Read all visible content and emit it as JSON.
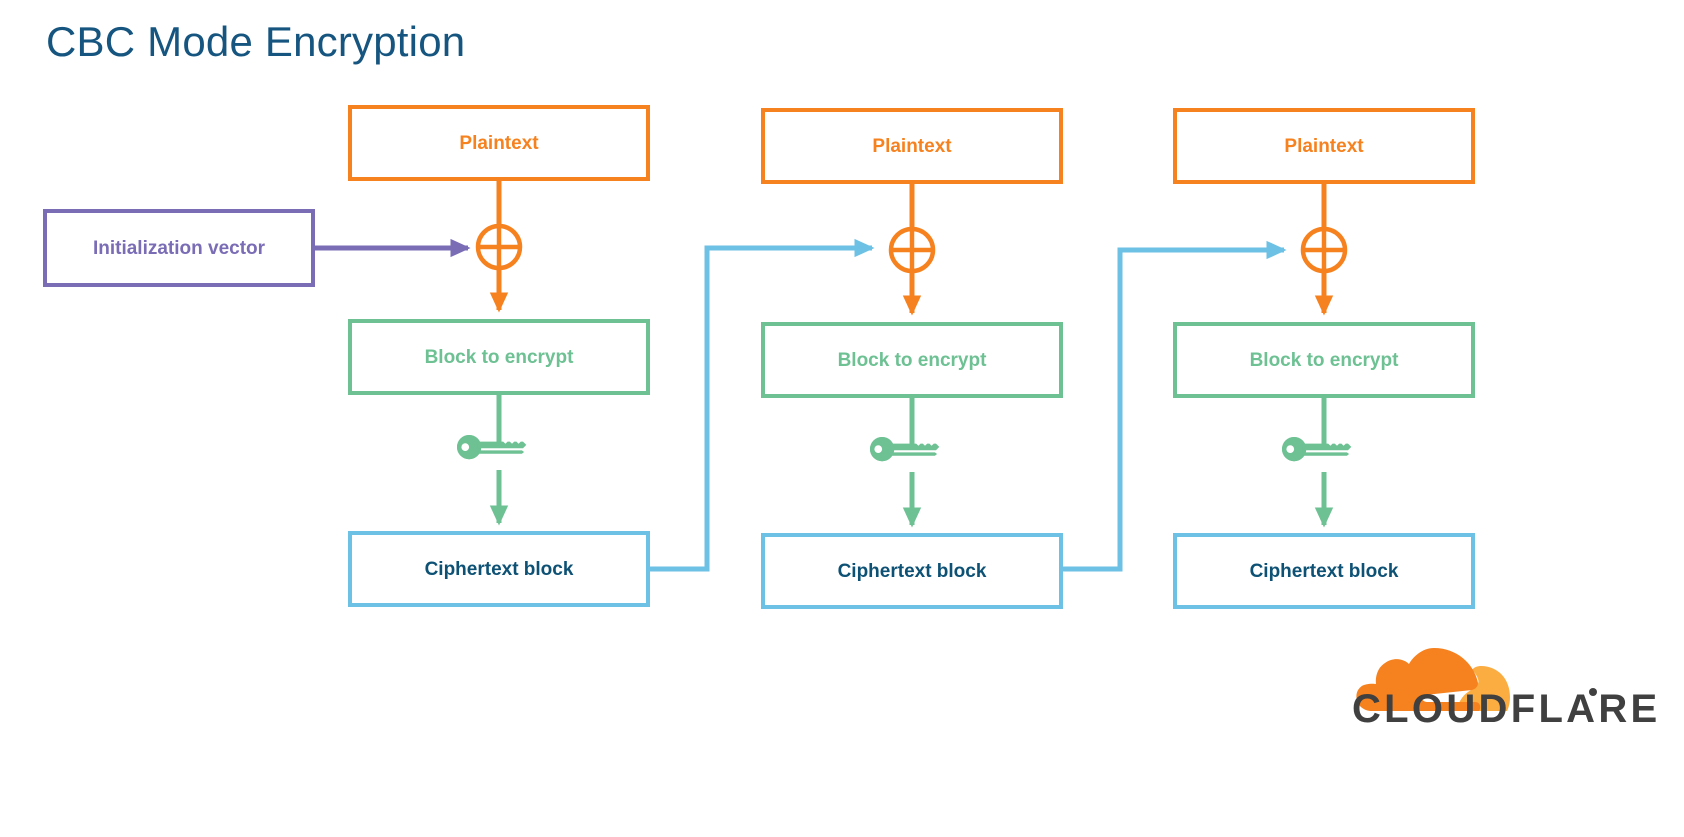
{
  "title": "CBC Mode Encryption",
  "theme": {
    "title_color": "#15557f",
    "plaintext_color": "#f6821f",
    "block_color": "#6dc193",
    "ciphertext_border_color": "#6cc1e5",
    "ciphertext_text_color": "#0d5175",
    "iv_color": "#7a6cb5",
    "background": "#ffffff"
  },
  "iv": {
    "label": "Initialization vector"
  },
  "labels": {
    "plaintext": "Plaintext",
    "block_to_encrypt": "Block to encrypt",
    "ciphertext_block": "Ciphertext block",
    "xor": "⊕",
    "key": "key-icon"
  },
  "stages": [
    {
      "index": 1,
      "plaintext": "Plaintext",
      "block": "Block to encrypt",
      "ciphertext": "Ciphertext block",
      "xor_input": "Initialization vector"
    },
    {
      "index": 2,
      "plaintext": "Plaintext",
      "block": "Block to encrypt",
      "ciphertext": "Ciphertext block",
      "xor_input": "Ciphertext block 1"
    },
    {
      "index": 3,
      "plaintext": "Plaintext",
      "block": "Block to encrypt",
      "ciphertext": "Ciphertext block",
      "xor_input": "Ciphertext block 2"
    }
  ],
  "logo": {
    "wordmark": "CLOUDFLARE",
    "registered_mark": "®",
    "cloud_icon": "cloudflare-cloud-icon"
  }
}
